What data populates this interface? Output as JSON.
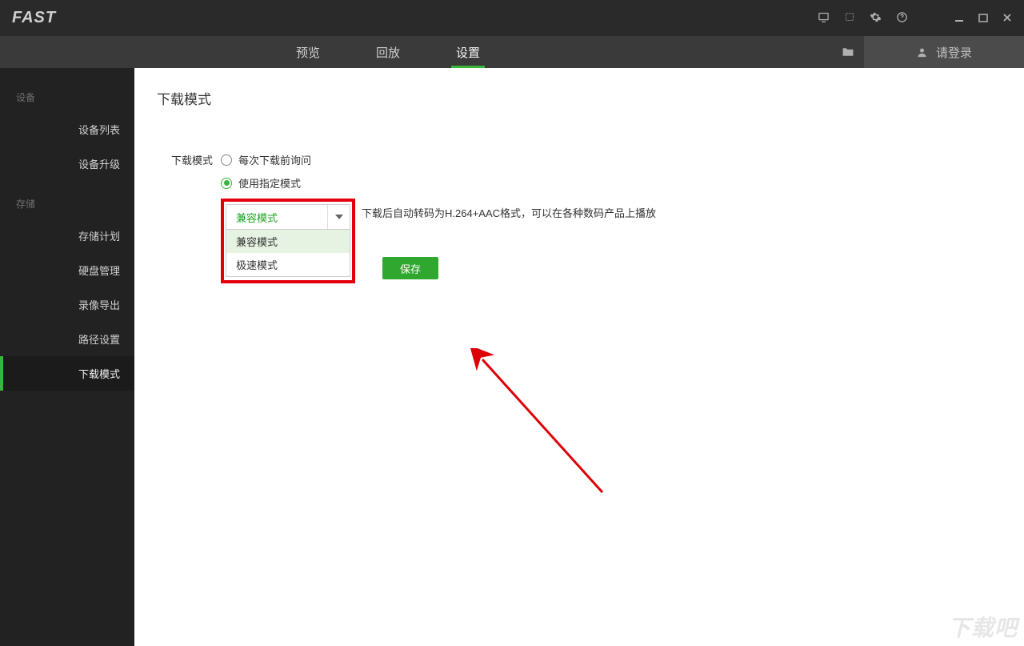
{
  "titlebar": {
    "logo": "FAST"
  },
  "menu": {
    "tabs": [
      {
        "label": "预览"
      },
      {
        "label": "回放"
      },
      {
        "label": "设置"
      }
    ],
    "login_label": "请登录"
  },
  "sidebar": {
    "groups": [
      {
        "title": "设备",
        "items": [
          "设备列表",
          "设备升级"
        ]
      },
      {
        "title": "存储",
        "items": [
          "存储计划",
          "硬盘管理",
          "录像导出",
          "路径设置",
          "下载模式"
        ]
      }
    ]
  },
  "page": {
    "title": "下载模式",
    "form_label": "下载模式",
    "radio1": "每次下载前询问",
    "radio2": "使用指定模式",
    "dropdown_selected": "兼容模式",
    "dropdown_options": [
      "兼容模式",
      "极速模式"
    ],
    "hint": "下载后自动转码为H.264+AAC格式，可以在各种数码产品上播放",
    "save_label": "保存",
    "watermark": "下载吧"
  }
}
